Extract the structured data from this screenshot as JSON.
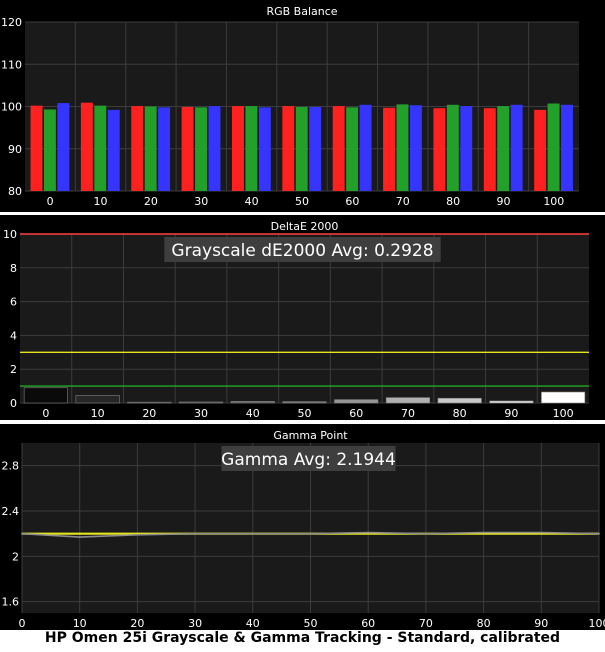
{
  "caption": "HP Omen 25i Grayscale & Gamma Tracking - Standard, calibrated",
  "colors": {
    "panel_bg": "#000000",
    "plot_bg": "#1a1a1a",
    "grid": "#3c3c3c",
    "text": "#ffffff",
    "red": "#ff2020",
    "green": "#22a02a",
    "blue": "#3535ff",
    "yellow": "#e6e61e",
    "limit_red": "#ff4040",
    "limit_green": "#22aa22",
    "gamma_gray": "#8c8c8c",
    "annotation_bg": "#3e3e3e"
  },
  "chart_data": [
    {
      "type": "bar",
      "title": "RGB Balance",
      "categories": [
        "0",
        "10",
        "20",
        "30",
        "40",
        "50",
        "60",
        "70",
        "80",
        "90",
        "100"
      ],
      "ylim": [
        80,
        120
      ],
      "yticks": [
        80,
        90,
        100,
        110,
        120
      ],
      "grid": true,
      "series": [
        {
          "color": "red",
          "values": [
            100.2,
            100.9,
            100.1,
            99.9,
            100.1,
            100.1,
            100.1,
            99.7,
            99.6,
            99.6,
            99.2
          ]
        },
        {
          "color": "green",
          "values": [
            99.3,
            100.2,
            100.0,
            99.8,
            100.1,
            99.9,
            99.8,
            100.5,
            100.4,
            100.1,
            100.7
          ]
        },
        {
          "color": "blue",
          "values": [
            100.8,
            99.2,
            99.8,
            100.1,
            99.8,
            99.9,
            100.4,
            100.3,
            100.1,
            100.4,
            100.4
          ]
        }
      ]
    },
    {
      "type": "bar",
      "title": "DeltaE 2000",
      "annotation": "Grayscale dE2000 Avg: 0.2928",
      "categories": [
        "0",
        "10",
        "20",
        "30",
        "40",
        "50",
        "60",
        "70",
        "80",
        "90",
        "100"
      ],
      "ylim": [
        0,
        10
      ],
      "yticks": [
        0,
        2,
        4,
        6,
        8,
        10
      ],
      "grid": true,
      "values": [
        0.9,
        0.45,
        0.05,
        0.06,
        0.1,
        0.08,
        0.2,
        0.32,
        0.28,
        0.12,
        0.65
      ],
      "bar_shades": [
        "#0a0a0a",
        "#262626",
        "#333333",
        "#4a4a4a",
        "#606060",
        "#7a7a7a",
        "#969696",
        "#b0b0b0",
        "#c8c8c8",
        "#e0e0e0",
        "#ffffff"
      ],
      "reference_lines": [
        {
          "value": 10,
          "color": "limit_red"
        },
        {
          "value": 3,
          "color": "yellow"
        },
        {
          "value": 1,
          "color": "limit_green"
        }
      ]
    },
    {
      "type": "line",
      "title": "Gamma Point",
      "annotation": "Gamma Avg: 2.1944",
      "x": [
        0,
        10,
        20,
        30,
        40,
        50,
        60,
        70,
        80,
        90,
        100
      ],
      "xticks": [
        0,
        10,
        20,
        30,
        40,
        50,
        60,
        70,
        80,
        90,
        100
      ],
      "xlim": [
        0,
        100
      ],
      "ylim": [
        1.5,
        3.0
      ],
      "yticks": [
        1.6,
        2.0,
        2.4,
        2.8
      ],
      "grid": true,
      "series": [
        {
          "color": "yellow",
          "values": [
            2.2,
            2.2,
            2.2,
            2.2,
            2.2,
            2.2,
            2.2,
            2.2,
            2.2,
            2.2,
            2.2
          ]
        },
        {
          "color": "gamma_gray",
          "values": [
            2.2,
            2.17,
            2.19,
            2.2,
            2.2,
            2.2,
            2.21,
            2.2,
            2.21,
            2.21,
            2.2
          ]
        }
      ]
    }
  ]
}
